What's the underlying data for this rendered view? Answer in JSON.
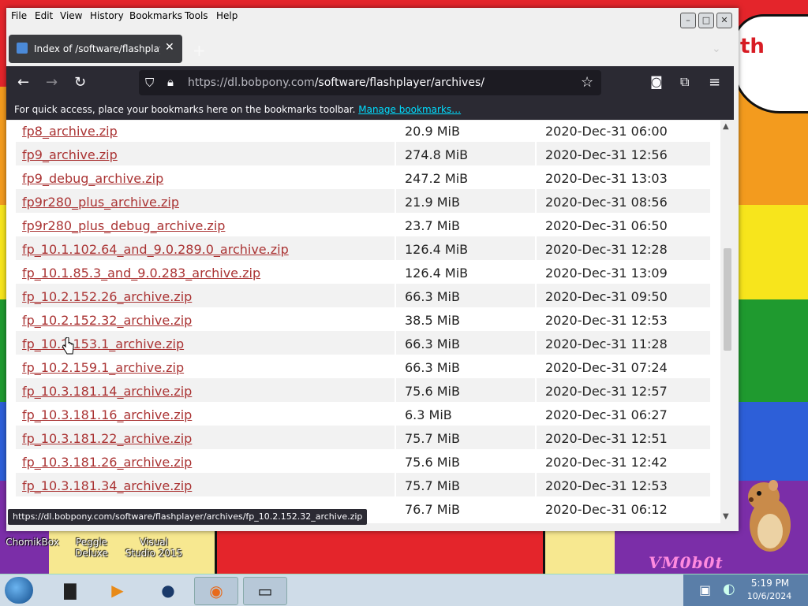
{
  "window": {
    "menu": [
      "File",
      "Edit",
      "View",
      "History",
      "Bookmarks",
      "Tools",
      "Help"
    ],
    "controls": {
      "minimize": "–",
      "maximize": "□",
      "close": "✕"
    }
  },
  "tab": {
    "title": "Index of /software/flashplayer/a",
    "close": "✕",
    "new_tab": "+"
  },
  "navbar": {
    "url_host": "https://dl.bobpony.com",
    "url_path": "/software/flashplayer/archives/"
  },
  "bookmarks_bar": {
    "text": "For quick access, place your bookmarks here on the bookmarks toolbar.",
    "link": "Manage bookmarks…"
  },
  "files": [
    {
      "name": "fp8_archive.zip",
      "size": "20.9 MiB",
      "date": "2020-Dec-31 06:00"
    },
    {
      "name": "fp9_archive.zip",
      "size": "274.8 MiB",
      "date": "2020-Dec-31 12:56"
    },
    {
      "name": "fp9_debug_archive.zip",
      "size": "247.2 MiB",
      "date": "2020-Dec-31 13:03"
    },
    {
      "name": "fp9r280_plus_archive.zip",
      "size": "21.9 MiB",
      "date": "2020-Dec-31 08:56"
    },
    {
      "name": "fp9r280_plus_debug_archive.zip",
      "size": "23.7 MiB",
      "date": "2020-Dec-31 06:50"
    },
    {
      "name": "fp_10.1.102.64_and_9.0.289.0_archive.zip",
      "size": "126.4 MiB",
      "date": "2020-Dec-31 12:28"
    },
    {
      "name": "fp_10.1.85.3_and_9.0.283_archive.zip",
      "size": "126.4 MiB",
      "date": "2020-Dec-31 13:09"
    },
    {
      "name": "fp_10.2.152.26_archive.zip",
      "size": "66.3 MiB",
      "date": "2020-Dec-31 09:50"
    },
    {
      "name": "fp_10.2.152.32_archive.zip",
      "size": "38.5 MiB",
      "date": "2020-Dec-31 12:53"
    },
    {
      "name": "fp_10.2.153.1_archive.zip",
      "size": "66.3 MiB",
      "date": "2020-Dec-31 11:28"
    },
    {
      "name": "fp_10.2.159.1_archive.zip",
      "size": "66.3 MiB",
      "date": "2020-Dec-31 07:24"
    },
    {
      "name": "fp_10.3.181.14_archive.zip",
      "size": "75.6 MiB",
      "date": "2020-Dec-31 12:57"
    },
    {
      "name": "fp_10.3.181.16_archive.zip",
      "size": "6.3 MiB",
      "date": "2020-Dec-31 06:27"
    },
    {
      "name": "fp_10.3.181.22_archive.zip",
      "size": "75.7 MiB",
      "date": "2020-Dec-31 12:51"
    },
    {
      "name": "fp_10.3.181.26_archive.zip",
      "size": "75.6 MiB",
      "date": "2020-Dec-31 12:42"
    },
    {
      "name": "fp_10.3.181.34_archive.zip",
      "size": "75.7 MiB",
      "date": "2020-Dec-31 12:53"
    },
    {
      "name": "",
      "size": "76.7 MiB",
      "date": "2020-Dec-31 06:12"
    }
  ],
  "status_url": "https://dl.bobpony.com/software/flashplayer/archives/fp_10.2.152.32_archive.zip",
  "desktop": {
    "icons": [
      "ChomikBox",
      "Peggle Deluxe",
      "Visual Studio 2015"
    ],
    "speech_text": "th",
    "signature": "VM0b0t"
  },
  "taskbar": {
    "time": "5:19 PM",
    "date": "10/6/2024"
  },
  "colors": {
    "link": "#aa3333",
    "nav_bg": "#2b2a33",
    "accent_link": "#00ddff"
  }
}
